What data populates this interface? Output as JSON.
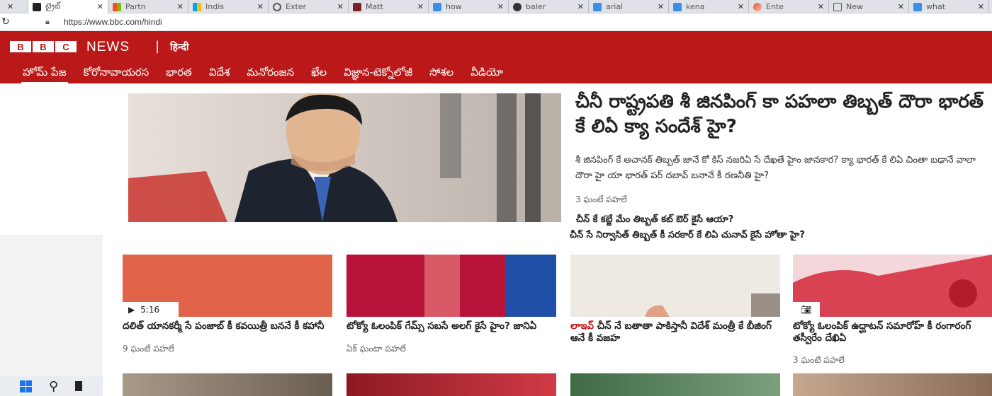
{
  "browser": {
    "tabs": [
      {
        "title": "",
        "active": false,
        "favicon": "close-icon"
      },
      {
        "title": "ట్రైబ్",
        "active": true,
        "favicon": "bbc-icon"
      },
      {
        "title": "Partn",
        "active": false,
        "favicon": "windows-logo-icon"
      },
      {
        "title": "Indis",
        "active": false,
        "favicon": "windows-logo-icon"
      },
      {
        "title": "Exter",
        "active": false,
        "favicon": "gear-icon"
      },
      {
        "title": "Matt",
        "active": false,
        "favicon": "book-icon"
      },
      {
        "title": "how",
        "active": false,
        "favicon": "bing-icon"
      },
      {
        "title": "baler",
        "active": false,
        "favicon": "github-icon"
      },
      {
        "title": "arial",
        "active": false,
        "favicon": "bing-icon"
      },
      {
        "title": "kena",
        "active": false,
        "favicon": "bing-icon"
      },
      {
        "title": "Ente",
        "active": false,
        "favicon": "edge-icon"
      },
      {
        "title": "New",
        "active": false,
        "favicon": "new-tab-icon"
      },
      {
        "title": "what",
        "active": false,
        "favicon": "bing-icon"
      }
    ],
    "url": "https://www.bbc.com/hindi"
  },
  "masthead": {
    "blocks": [
      "B",
      "B",
      "C"
    ],
    "news": "NEWS",
    "separator": "|",
    "language": "हिन्दी"
  },
  "nav": {
    "items": [
      "హోమ్ పేజ",
      "కోరోనావాయరస",
      "భారత",
      "విదేశ",
      "మనోరంజన",
      "ఖేల",
      "విజ్ఞాన-టెక్నోలోజీ",
      "సోశల",
      "వీడియో"
    ]
  },
  "hero": {
    "title": "చీనీ రాష్ట్రపతి శీ జినపింగ్ కా పహలా తిబ్బత్ దౌరా భారత్ కే లిఏ క్యా సందేశ్ హై?",
    "summary": "శీ జినపింగ్ కే అచానక్ తిబ్బత్ జానే కో కిస్ నజరిఏ సే దేఖతే హైం జానకార? క్యా భారత్ కే లిఏ చింతా బఢానే వాలా దౌరా హై యా భారత్ పర్ దబావ్ బనానే కీ రణనీతి హై?",
    "time": "3 ఘంటే పహలే",
    "related": [
      "చీన్ కే కబ్జే మేం తిబ్బత్ కబ్ ఔర్ కైసే ఆయా?",
      "చీన్ సే నిర్వాసిత్ తిబ్బత్ కీ సరకార్ కే లిఏ చునావ్ కైసే హోతా హై?"
    ]
  },
  "cards": [
    {
      "title": "దలిత్ యానకర్మీ సే పంజాబ్ కీ కవయిత్రీ బననే కీ కహానీ",
      "time": "9 ఘంటే పహలే",
      "duration": "5:16",
      "live": ""
    },
    {
      "title": "టోక్యో ఓలంపిక్ గేమ్స్ సబసే అలగ్ కైసే హైం? జానిఏ",
      "time": "ఏక్ ఘంటా పహలే",
      "duration": "",
      "live": ""
    },
    {
      "title": "చీన్ నే బతాతా పాకిస్తానీ విదేశ్ మంత్రీ కే బీజింగ్ ఆనే కీ వజహ",
      "time": "",
      "duration": "",
      "live": "లాఇవ్"
    },
    {
      "title": "టోక్యో ఓలంపిక్ ఉద్ఘాటన్ సమారోహ్ కీ రంగారంగ్ తస్వీరేం దేఖిఏ",
      "time": "3 ఘంటే పహలే",
      "duration": "",
      "live": ""
    }
  ],
  "colors": {
    "brand_red": "#bb1919",
    "text": "#222222",
    "muted": "#666666"
  }
}
